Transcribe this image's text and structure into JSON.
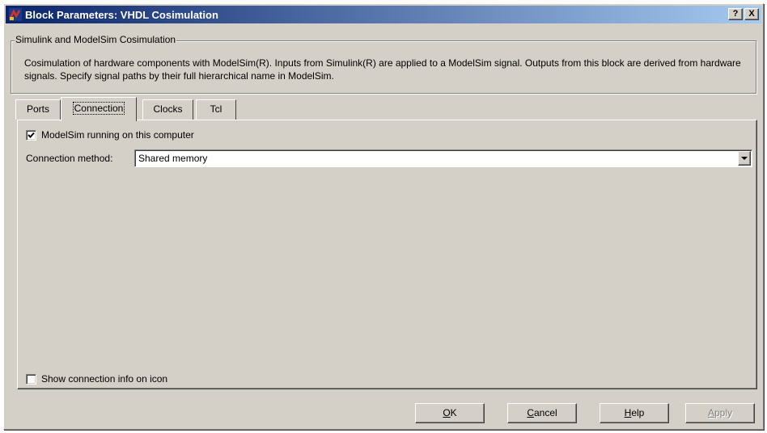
{
  "window": {
    "title": "Block Parameters: VHDL Cosimulation",
    "title_buttons": [
      "?",
      "X"
    ]
  },
  "group": {
    "legend": "Simulink and ModelSim Cosimulation",
    "description": "Cosimulation of hardware components with ModelSim(R). Inputs from Simulink(R) are applied to a ModelSim signal. Outputs from this block are derived from hardware signals. Specify signal paths by their full hierarchical name in ModelSim."
  },
  "tabs": [
    {
      "label": "Ports",
      "active": false
    },
    {
      "label": "Connection",
      "active": true
    },
    {
      "label": "Clocks",
      "active": false
    },
    {
      "label": "Tcl",
      "active": false
    }
  ],
  "connection": {
    "modelsim_local_label": "ModelSim running on this computer",
    "modelsim_local_checked": true,
    "method_label": "Connection method:",
    "method_value": "Shared memory",
    "show_info_label": "Show connection info on icon",
    "show_info_checked": false
  },
  "buttons": {
    "ok": {
      "accel": "O",
      "rest": "K"
    },
    "cancel": {
      "accel": "C",
      "rest": "ancel"
    },
    "help": {
      "accel": "H",
      "rest": "elp"
    },
    "apply": {
      "accel": "A",
      "rest": "pply",
      "disabled": true
    }
  },
  "colors": {
    "face": "#d4d0c8",
    "title_start": "#0a246a",
    "title_end": "#a6caf0"
  },
  "icons": {
    "title": "simulink-block-icon",
    "combo": "chevron-down-icon",
    "check": "checkmark-icon"
  }
}
